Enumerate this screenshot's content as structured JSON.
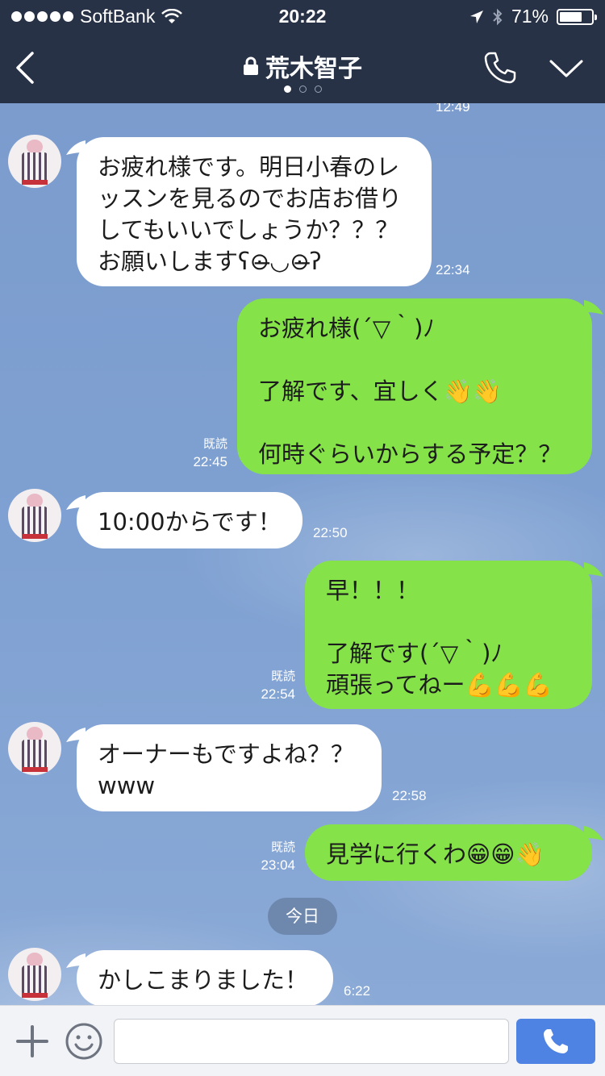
{
  "status_bar": {
    "carrier": "SoftBank",
    "time": "20:22",
    "battery": "71%",
    "battery_level": 0.71
  },
  "header": {
    "title": "荒木智子",
    "page_dots": 3,
    "active_page": 0
  },
  "top_partial_time": "12:49",
  "messages": [
    {
      "side": "in",
      "text": "お疲れ様です。明日小春のレ\nッスンを見るのでお店お借り\nしてもいいでしょうか？？？\nお願いしますʕ⊙̶◡⊙̶ʔ",
      "time": "22:34"
    },
    {
      "side": "out",
      "text": "お疲れ様(´▽｀)ﾉ\n\n了解です、宜しく👋👋\n\n何時ぐらいからする予定？？",
      "read": "既読",
      "time": "22:45"
    },
    {
      "side": "in",
      "text": "10:00からです！",
      "time": "22:50"
    },
    {
      "side": "out",
      "text": "早！！！\n\n了解です(´▽｀)ﾉ\n頑張ってねー💪💪💪",
      "read": "既読",
      "time": "22:54"
    },
    {
      "side": "in",
      "text": "オーナーもですよね？？\nwww",
      "time": "22:58"
    },
    {
      "side": "out",
      "text": "見学に行くわ😁😁👋",
      "read": "既読",
      "time": "23:04"
    },
    {
      "side": "in",
      "text": "かしこまりました！",
      "time": "6:22"
    }
  ],
  "date_divider": "今日",
  "input": {
    "placeholder": "",
    "value": ""
  },
  "colors": {
    "header_bg": "#273246",
    "outgoing_bubble": "#85e249",
    "incoming_bubble": "#ffffff",
    "call_button": "#4f83e3"
  }
}
